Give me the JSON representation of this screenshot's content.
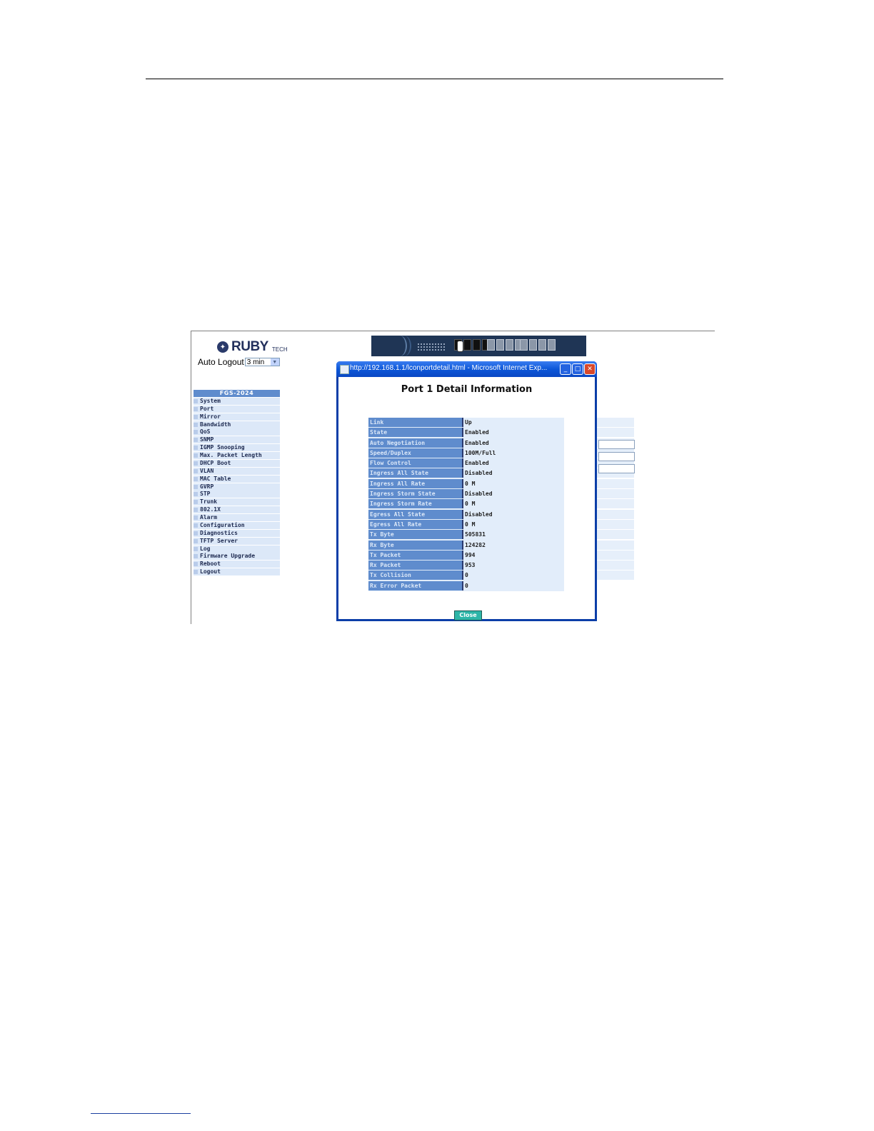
{
  "logo": {
    "text": "RUBY",
    "sup": "TECH"
  },
  "auto_logout": {
    "label": "Auto Logout",
    "value": "3 min"
  },
  "menu": {
    "title": "FGS-2024",
    "items": [
      "System",
      "Port",
      "Mirror",
      "Bandwidth",
      "QoS",
      "SNMP",
      "IGMP Snooping",
      "Max. Packet Length",
      "DHCP Boot",
      "VLAN",
      "MAC Table",
      "GVRP",
      "STP",
      "Trunk",
      "802.1X",
      "Alarm",
      "Configuration",
      "Diagnostics",
      "TFTP Server",
      "Log",
      "Firmware Upgrade",
      "Reboot",
      "Logout"
    ]
  },
  "popup": {
    "window_title": "http://192.168.1.1/lconportdetail.html - Microsoft Internet Exp...",
    "heading": "Port 1 Detail Information",
    "rows": [
      {
        "label": "Link",
        "value": "Up"
      },
      {
        "label": "State",
        "value": "Enabled"
      },
      {
        "label": "Auto Negotiation",
        "value": "Enabled"
      },
      {
        "label": "Speed/Duplex",
        "value": "100M/Full"
      },
      {
        "label": "Flow Control",
        "value": "Enabled"
      },
      {
        "label": "Ingress All State",
        "value": "Disabled"
      },
      {
        "label": "Ingress All Rate",
        "value": "0 M"
      },
      {
        "label": "Ingress Storm State",
        "value": "Disabled"
      },
      {
        "label": "Ingress Storm Rate",
        "value": "0 M"
      },
      {
        "label": "Egress All State",
        "value": "Disabled"
      },
      {
        "label": "Egress All Rate",
        "value": "0 M"
      },
      {
        "label": "Tx Byte",
        "value": "505831"
      },
      {
        "label": "Rx Byte",
        "value": "124282"
      },
      {
        "label": "Tx Packet",
        "value": "994"
      },
      {
        "label": "Rx Packet",
        "value": "953"
      },
      {
        "label": "Tx Collision",
        "value": "0"
      },
      {
        "label": "Rx Error Packet",
        "value": "0"
      }
    ],
    "close_label": "Close"
  },
  "colors": {
    "accent": "#5f8ccd",
    "row_bg": "#e2edfa",
    "titlebar": "#0c56d8"
  },
  "icons": {
    "minimize": "minimize-icon",
    "maximize": "maximize-icon",
    "close": "close-icon",
    "dropdown": "chevron-down-icon"
  }
}
